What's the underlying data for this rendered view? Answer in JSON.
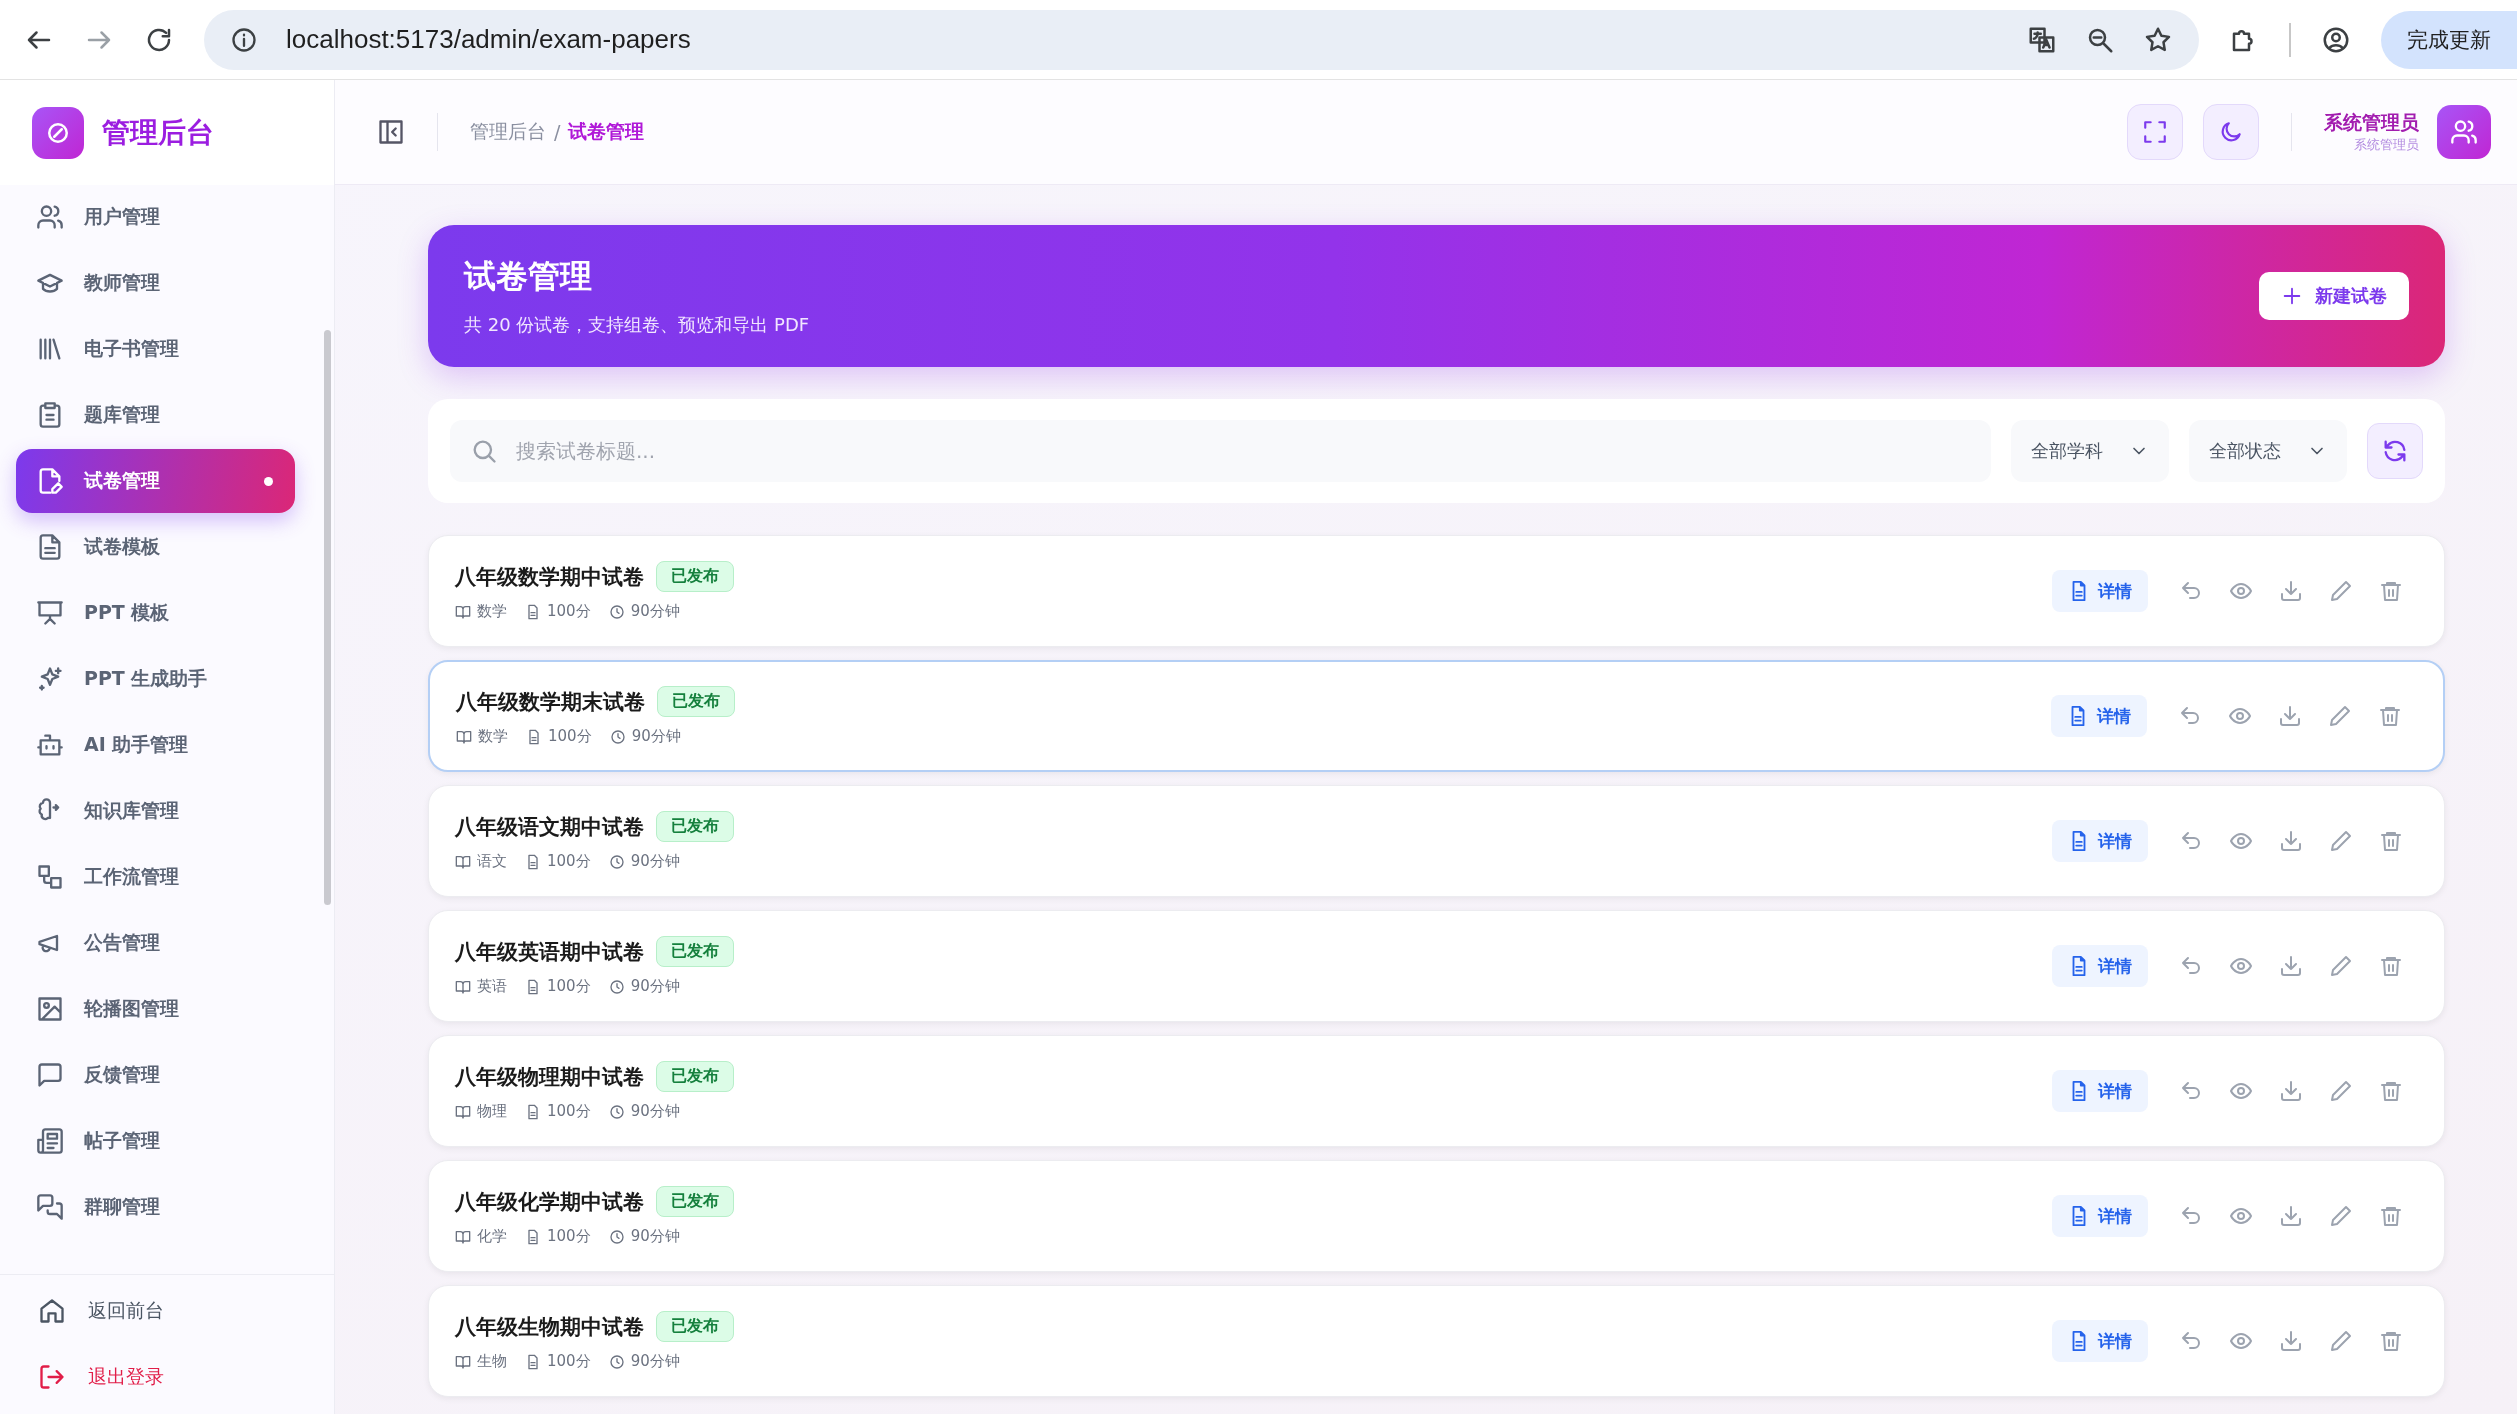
{
  "browser": {
    "url": "localhost:5173/admin/exam-papers",
    "update_button": "完成更新"
  },
  "sidebar": {
    "brand": "管理后台",
    "items": [
      {
        "label": "用户管理",
        "selected": false
      },
      {
        "label": "教师管理",
        "selected": false
      },
      {
        "label": "电子书管理",
        "selected": false
      },
      {
        "label": "题库管理",
        "selected": false
      },
      {
        "label": "试卷管理",
        "selected": true
      },
      {
        "label": "试卷模板",
        "selected": false
      },
      {
        "label": "PPT 模板",
        "selected": false
      },
      {
        "label": "PPT 生成助手",
        "selected": false
      },
      {
        "label": "AI 助手管理",
        "selected": false
      },
      {
        "label": "知识库管理",
        "selected": false
      },
      {
        "label": "工作流管理",
        "selected": false
      },
      {
        "label": "公告管理",
        "selected": false
      },
      {
        "label": "轮播图管理",
        "selected": false
      },
      {
        "label": "反馈管理",
        "selected": false
      },
      {
        "label": "帖子管理",
        "selected": false
      },
      {
        "label": "群聊管理",
        "selected": false
      }
    ],
    "footer": [
      {
        "label": "返回前台",
        "kind": "home"
      },
      {
        "label": "退出登录",
        "kind": "logout"
      }
    ]
  },
  "header": {
    "breadcrumb": [
      {
        "label": "管理后台",
        "selected": false
      },
      {
        "label": "/",
        "selected": false
      },
      {
        "label": "试卷管理",
        "selected": true
      }
    ],
    "user": {
      "name": "系统管理员",
      "role": "系统管理员"
    }
  },
  "banner": {
    "title": "试卷管理",
    "subtitle": "共 20 份试卷，支持组卷、预览和导出 PDF",
    "new_button": "新建试卷"
  },
  "filters": {
    "search_placeholder": "搜索试卷标题...",
    "subject": "全部学科",
    "status": "全部状态"
  },
  "papers": [
    {
      "title": "八年级数学期中试卷",
      "status": "已发布",
      "subject": "数学",
      "score": "100分",
      "duration": "90分钟",
      "detail_button": "详情",
      "selected": false
    },
    {
      "title": "八年级数学期末试卷",
      "status": "已发布",
      "subject": "数学",
      "score": "100分",
      "duration": "90分钟",
      "detail_button": "详情",
      "selected": true
    },
    {
      "title": "八年级语文期中试卷",
      "status": "已发布",
      "subject": "语文",
      "score": "100分",
      "duration": "90分钟",
      "detail_button": "详情",
      "selected": false
    },
    {
      "title": "八年级英语期中试卷",
      "status": "已发布",
      "subject": "英语",
      "score": "100分",
      "duration": "90分钟",
      "detail_button": "详情",
      "selected": false
    },
    {
      "title": "八年级物理期中试卷",
      "status": "已发布",
      "subject": "物理",
      "score": "100分",
      "duration": "90分钟",
      "detail_button": "详情",
      "selected": false
    },
    {
      "title": "八年级化学期中试卷",
      "status": "已发布",
      "subject": "化学",
      "score": "100分",
      "duration": "90分钟",
      "detail_button": "详情",
      "selected": false
    },
    {
      "title": "八年级生物期中试卷",
      "status": "已发布",
      "subject": "生物",
      "score": "100分",
      "duration": "90分钟",
      "detail_button": "详情",
      "selected": false
    }
  ]
}
